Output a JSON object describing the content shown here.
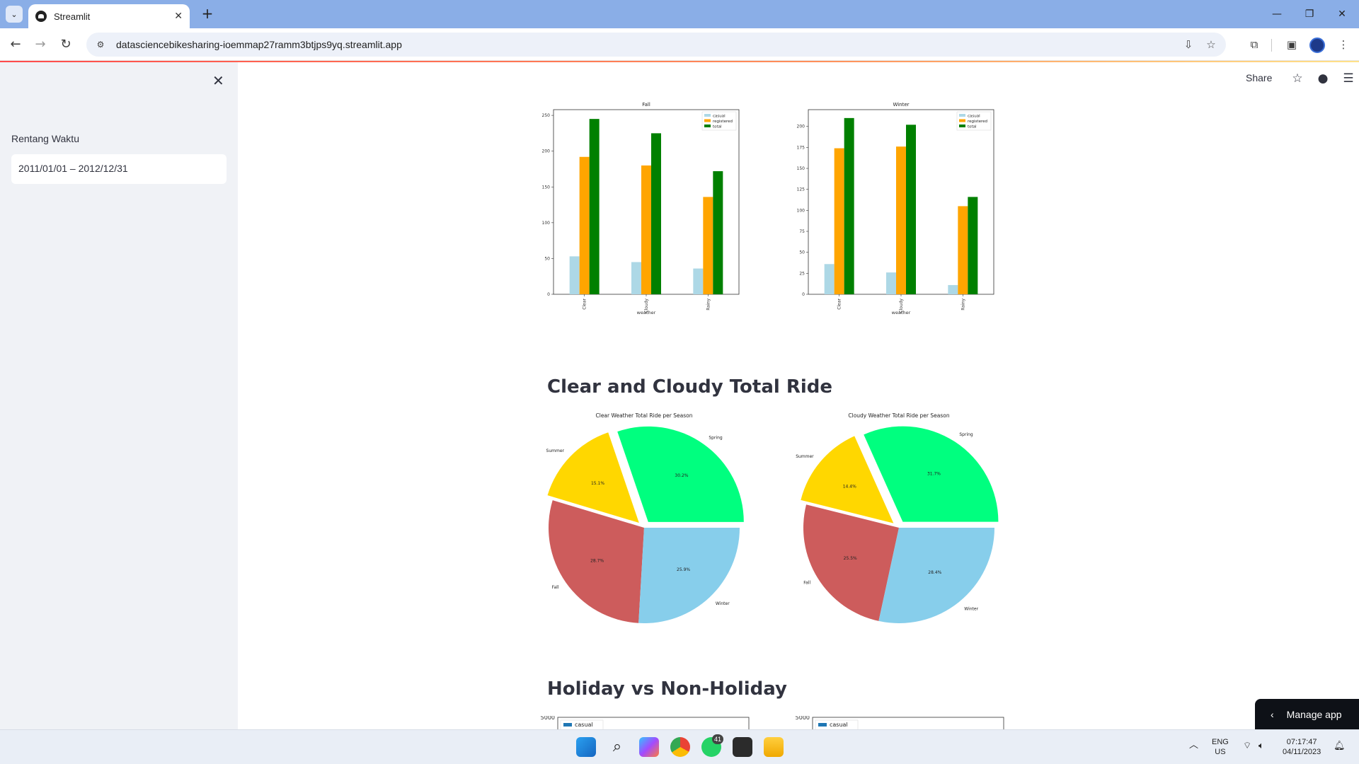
{
  "browser": {
    "tab_title": "Streamlit",
    "url": "datasciencebikesharing-ioemmap27ramm3btjps9yq.streamlit.app"
  },
  "sidebar": {
    "date_label": "Rentang Waktu",
    "date_value": "2011/01/01 – 2012/12/31"
  },
  "header": {
    "share_label": "Share"
  },
  "sections": {
    "pie_title": "Clear and Cloudy Total Ride",
    "holiday_title": "Holiday vs Non-Holiday"
  },
  "manage_app": {
    "label": "Manage app"
  },
  "taskbar": {
    "lang_top": "ENG",
    "lang_bottom": "US",
    "time": "07:17:47",
    "date": "04/11/2023",
    "whatsapp_badge": "41"
  },
  "colors": {
    "casual": "#add8e6",
    "registered": "#ffa500",
    "total": "#008000",
    "spring": "#00ff7f",
    "summer": "#ffd700",
    "fall": "#cd5c5c",
    "winter": "#87ceeb"
  },
  "chart_data": [
    {
      "type": "bar",
      "title": "Fall",
      "xlabel": "weather",
      "categories": [
        "Clear",
        "Cloudy",
        "Rainy"
      ],
      "series": [
        {
          "name": "casual",
          "values": [
            53,
            45,
            36
          ]
        },
        {
          "name": "registered",
          "values": [
            192,
            180,
            136
          ]
        },
        {
          "name": "total",
          "values": [
            245,
            225,
            172
          ]
        }
      ],
      "ylim": [
        0,
        258
      ],
      "yticks": [
        0,
        50,
        100,
        150,
        200,
        250
      ],
      "legend": "top-right"
    },
    {
      "type": "bar",
      "title": "Winter",
      "xlabel": "weather",
      "categories": [
        "Clear",
        "Cloudy",
        "Rainy"
      ],
      "series": [
        {
          "name": "casual",
          "values": [
            36,
            26,
            11
          ]
        },
        {
          "name": "registered",
          "values": [
            174,
            176,
            105
          ]
        },
        {
          "name": "total",
          "values": [
            210,
            202,
            116
          ]
        }
      ],
      "ylim": [
        0,
        220
      ],
      "yticks": [
        0,
        25,
        50,
        75,
        100,
        125,
        150,
        175,
        200
      ],
      "legend": "top-right"
    },
    {
      "type": "pie",
      "title": "Clear Weather Total Ride per Season",
      "labels": [
        "Spring",
        "Summer",
        "Fall",
        "Winter"
      ],
      "values": [
        30.2,
        15.1,
        28.7,
        25.9
      ],
      "value_labels": [
        "30.2%",
        "15.1%",
        "28.7%",
        "25.9%"
      ],
      "exploded": [
        "Spring",
        "Summer"
      ]
    },
    {
      "type": "pie",
      "title": "Cloudy Weather Total Ride per Season",
      "labels": [
        "Spring",
        "Summer",
        "Fall",
        "Winter"
      ],
      "values": [
        31.7,
        14.4,
        25.5,
        28.4
      ],
      "value_labels": [
        "31.7%",
        "14.4%",
        "25.5%",
        "28.4%"
      ],
      "exploded": [
        "Spring",
        "Summer"
      ]
    },
    {
      "type": "bar",
      "title": "",
      "legend_visible": [
        "casual"
      ],
      "yticks_visible": [
        5000
      ]
    },
    {
      "type": "bar",
      "title": "",
      "legend_visible": [
        "casual"
      ],
      "yticks_visible": [
        5000
      ]
    }
  ]
}
